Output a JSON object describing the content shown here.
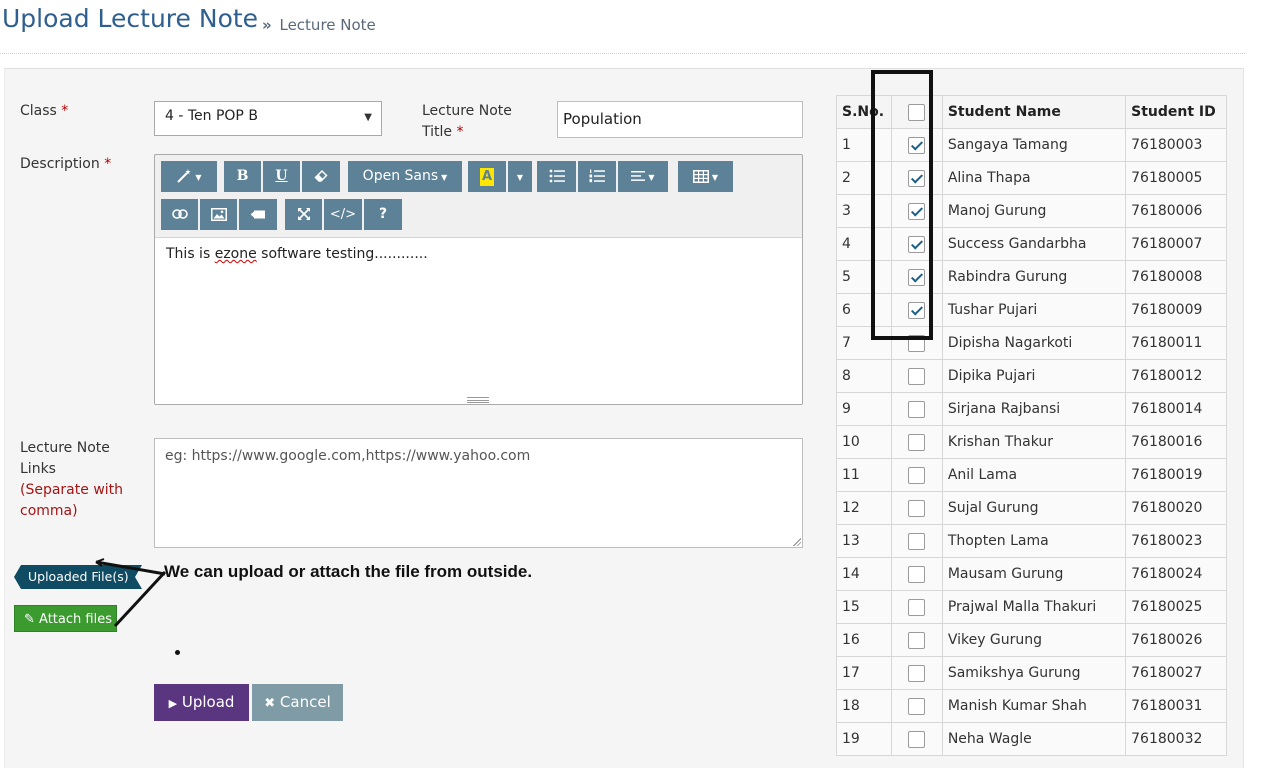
{
  "header": {
    "title": "Upload Lecture Note",
    "breadcrumb_sep": "»",
    "breadcrumb": "Lecture Note"
  },
  "form": {
    "class_label": "Class",
    "required_mark": "*",
    "class_value": "4 - Ten POP B",
    "title_label_line1": "Lecture Note",
    "title_label_line2": "Title",
    "title_value": "Population",
    "description_label": "Description",
    "editor_toolbar": {
      "font_name": "Open Sans",
      "bold": "B",
      "underline": "U",
      "help": "?",
      "code": "</>"
    },
    "description_text_before": "This is ",
    "description_text_spell": "ezone",
    "description_text_after": " software testing............",
    "links_label_line1": "Lecture Note",
    "links_label_line2": "Links",
    "links_hint_line1": "(Separate with",
    "links_hint_line2": "comma)",
    "links_placeholder": "eg: https://www.google.com,https://www.yahoo.com",
    "uploaded_files_label": "Uploaded File(s)",
    "attach_files_label": "Attach files",
    "annotation": "We can upload or attach the file from outside.",
    "upload_button": "Upload",
    "cancel_button": "Cancel"
  },
  "student_table": {
    "headers": {
      "sn": "S.No.",
      "name": "Student Name",
      "id": "Student ID"
    },
    "rows": [
      {
        "sn": "1",
        "checked": true,
        "name": "Sangaya Tamang",
        "id": "76180003"
      },
      {
        "sn": "2",
        "checked": true,
        "name": "Alina Thapa",
        "id": "76180005"
      },
      {
        "sn": "3",
        "checked": true,
        "name": "Manoj Gurung",
        "id": "76180006"
      },
      {
        "sn": "4",
        "checked": true,
        "name": "Success Gandarbha",
        "id": "76180007"
      },
      {
        "sn": "5",
        "checked": true,
        "name": "Rabindra Gurung",
        "id": "76180008"
      },
      {
        "sn": "6",
        "checked": true,
        "name": "Tushar Pujari",
        "id": "76180009"
      },
      {
        "sn": "7",
        "checked": false,
        "name": "Dipisha Nagarkoti",
        "id": "76180011"
      },
      {
        "sn": "8",
        "checked": false,
        "name": "Dipika Pujari",
        "id": "76180012"
      },
      {
        "sn": "9",
        "checked": false,
        "name": "Sirjana Rajbansi",
        "id": "76180014"
      },
      {
        "sn": "10",
        "checked": false,
        "name": "Krishan Thakur",
        "id": "76180016"
      },
      {
        "sn": "11",
        "checked": false,
        "name": "Anil Lama",
        "id": "76180019"
      },
      {
        "sn": "12",
        "checked": false,
        "name": "Sujal Gurung",
        "id": "76180020"
      },
      {
        "sn": "13",
        "checked": false,
        "name": "Thopten Lama",
        "id": "76180023"
      },
      {
        "sn": "14",
        "checked": false,
        "name": "Mausam Gurung",
        "id": "76180024"
      },
      {
        "sn": "15",
        "checked": false,
        "name": "Prajwal Malla Thakuri",
        "id": "76180025"
      },
      {
        "sn": "16",
        "checked": false,
        "name": "Vikey Gurung",
        "id": "76180026"
      },
      {
        "sn": "17",
        "checked": false,
        "name": "Samikshya Gurung",
        "id": "76180027"
      },
      {
        "sn": "18",
        "checked": false,
        "name": "Manish Kumar Shah",
        "id": "76180031"
      },
      {
        "sn": "19",
        "checked": false,
        "name": "Neha Wagle",
        "id": "76180032"
      }
    ]
  },
  "colors": {
    "title": "#2e5f8e",
    "toolbar": "#5d8196",
    "upload_button": "#5a3680",
    "cancel_button": "#7e9ba6",
    "attach_button": "#3b9b2f",
    "uploaded_tag": "#0f4c64",
    "required": "#b30000"
  }
}
